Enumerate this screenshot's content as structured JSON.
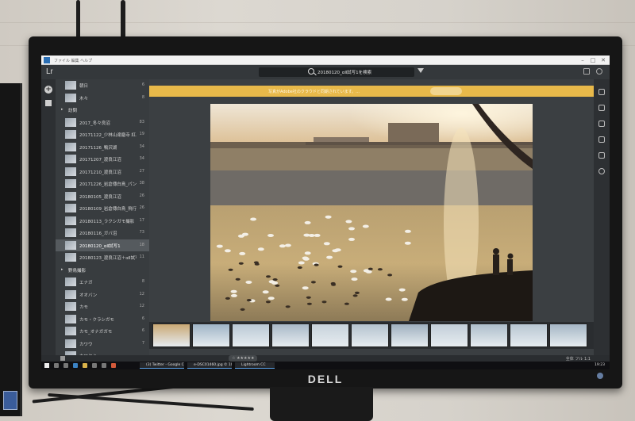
{
  "app": {
    "logo": "Lr",
    "search_text": "20180120_αⅡ試写1を検索",
    "menu": "ファイル  編集  ヘルプ"
  },
  "banner": {
    "text": "写真がAdobe社のクラウドと同期されています。...",
    "button": ""
  },
  "sidebar": {
    "items": [
      {
        "label": "朝日",
        "count": "6",
        "type": "album"
      },
      {
        "label": "木々",
        "count": "8",
        "type": "album"
      },
      {
        "label": "訪問",
        "count": "",
        "type": "group"
      },
      {
        "label": "2017_冬々良沼",
        "count": "83",
        "type": "album"
      },
      {
        "label": "20171122_少林山達磨寺 紅...",
        "count": "19",
        "type": "album"
      },
      {
        "label": "20171126_鴨沢湖",
        "count": "34",
        "type": "album"
      },
      {
        "label": "20171207_渡良江沼",
        "count": "34",
        "type": "album"
      },
      {
        "label": "20171210_渡良江沼",
        "count": "27",
        "type": "album"
      },
      {
        "label": "20171226_岩倉傳白鳥_パン...",
        "count": "38",
        "type": "album"
      },
      {
        "label": "20180105_渡良江沼",
        "count": "26",
        "type": "album"
      },
      {
        "label": "20180109_岩倉傳白鳥_飛行",
        "count": "26",
        "type": "album"
      },
      {
        "label": "20180113_ラクシガモ撮影",
        "count": "17",
        "type": "album"
      },
      {
        "label": "20180116_ガバ沼",
        "count": "73",
        "type": "album"
      },
      {
        "label": "20180120_αⅡ試写1",
        "count": "18",
        "type": "album",
        "selected": true
      },
      {
        "label": "20180123_渡良江沼＋αⅡ試写",
        "count": "11",
        "type": "album"
      },
      {
        "label": "野鳥撮影",
        "count": "",
        "type": "group"
      },
      {
        "label": "エナガ",
        "count": "8",
        "type": "album"
      },
      {
        "label": "オオバン",
        "count": "12",
        "type": "album"
      },
      {
        "label": "カモ",
        "count": "12",
        "type": "album"
      },
      {
        "label": "カモ・クラシガモ",
        "count": "6",
        "type": "album"
      },
      {
        "label": "カモ_オナガガモ",
        "count": "6",
        "type": "album"
      },
      {
        "label": "カワウ",
        "count": "7",
        "type": "album"
      },
      {
        "label": "カワセミ",
        "count": "",
        "type": "album"
      }
    ]
  },
  "bottombar": {
    "rating": "☆ ★★★★★",
    "right": "全体  フル  1:1"
  },
  "taskbar": {
    "tasks": [
      "(3) Twitter - Google C...",
      "e-DSC01460.jpg © 10...",
      "Lightroom CC"
    ],
    "clock": "19:23"
  },
  "bezel": {
    "brand": "DELL"
  }
}
